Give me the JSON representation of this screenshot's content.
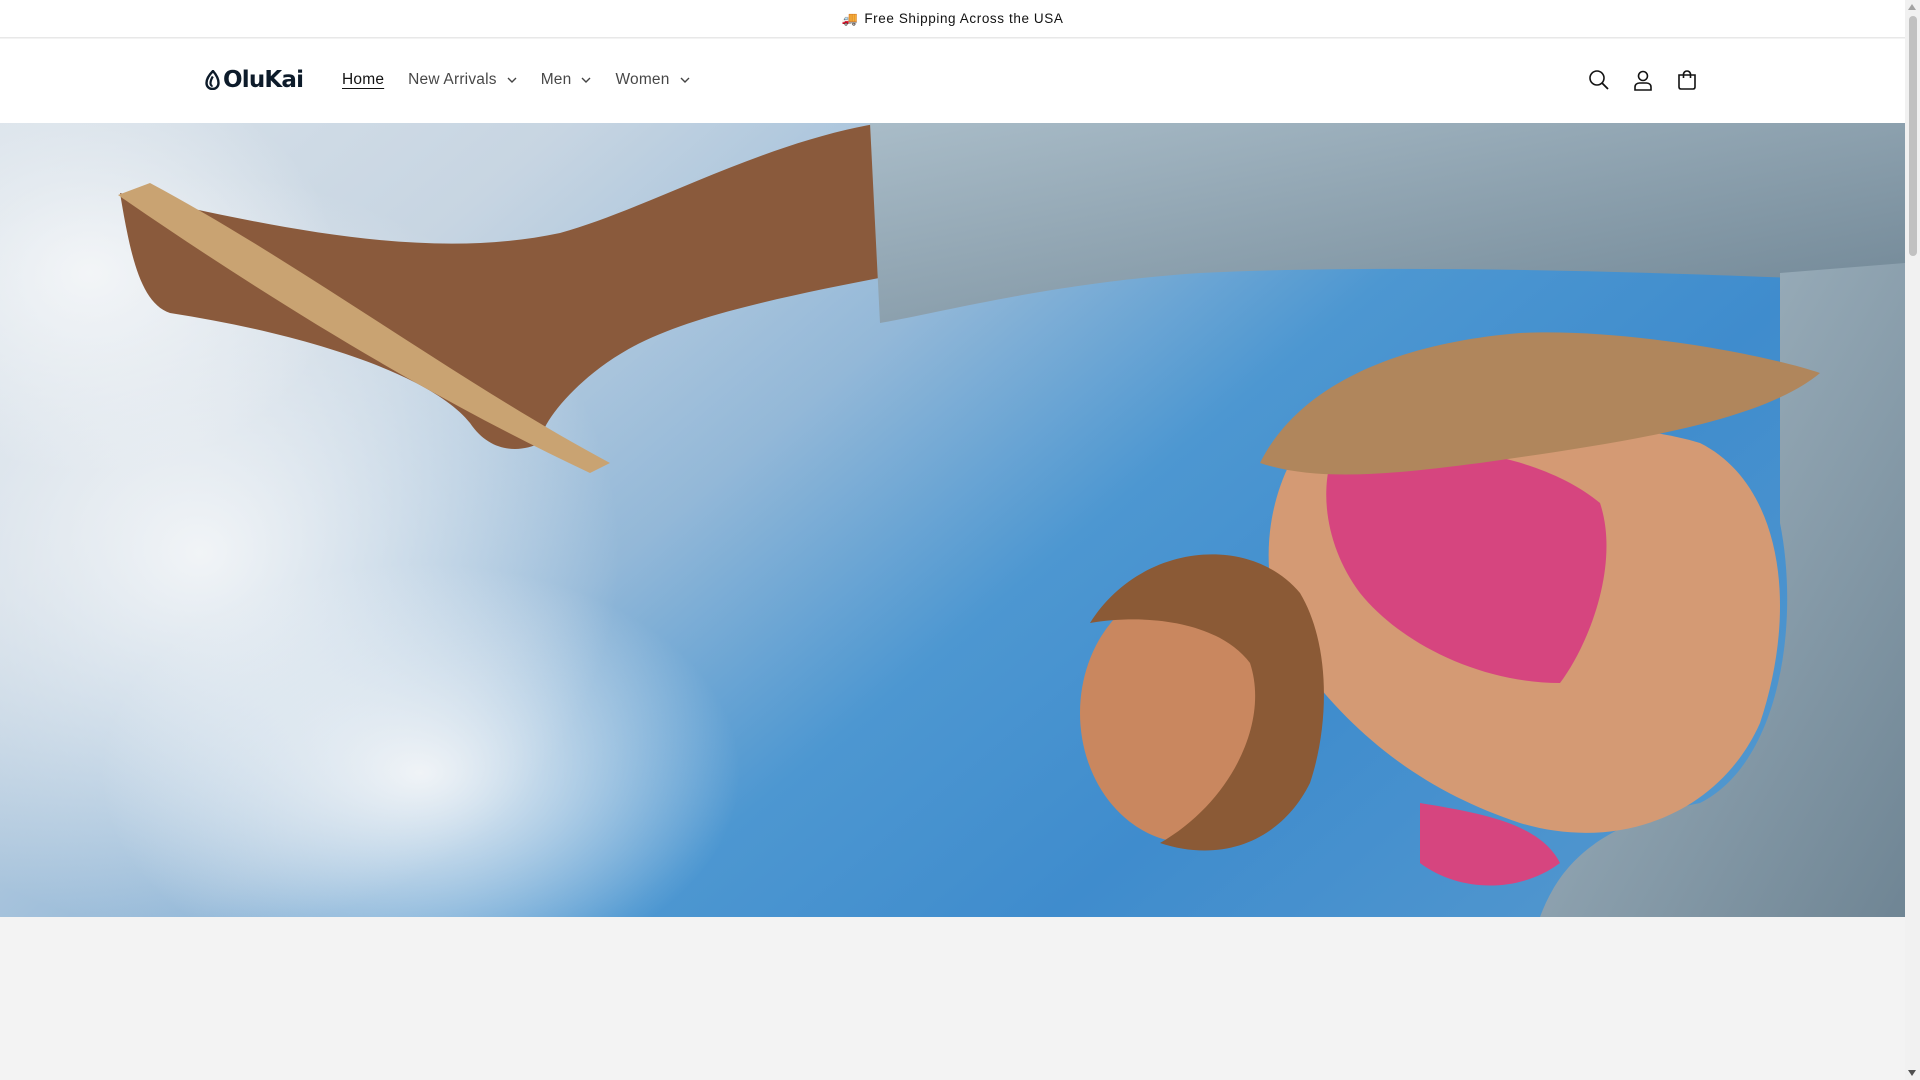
{
  "announcement": {
    "icon": "truck-icon",
    "text": "Free Shipping Across the USA"
  },
  "header": {
    "logo_text": "OluKai",
    "nav": [
      {
        "label": "Home",
        "active": true,
        "has_dropdown": false
      },
      {
        "label": "New Arrivals",
        "active": false,
        "has_dropdown": true
      },
      {
        "label": "Men",
        "active": false,
        "has_dropdown": true
      },
      {
        "label": "Women",
        "active": false,
        "has_dropdown": true
      }
    ],
    "icons": [
      "search-icon",
      "account-icon",
      "cart-icon"
    ]
  },
  "hero": {
    "image": "hero-banner-image"
  },
  "colors": {
    "text": "#121212",
    "background": "#ffffff",
    "section_background": "#f3f3f3",
    "sky": "#4d97d1"
  }
}
